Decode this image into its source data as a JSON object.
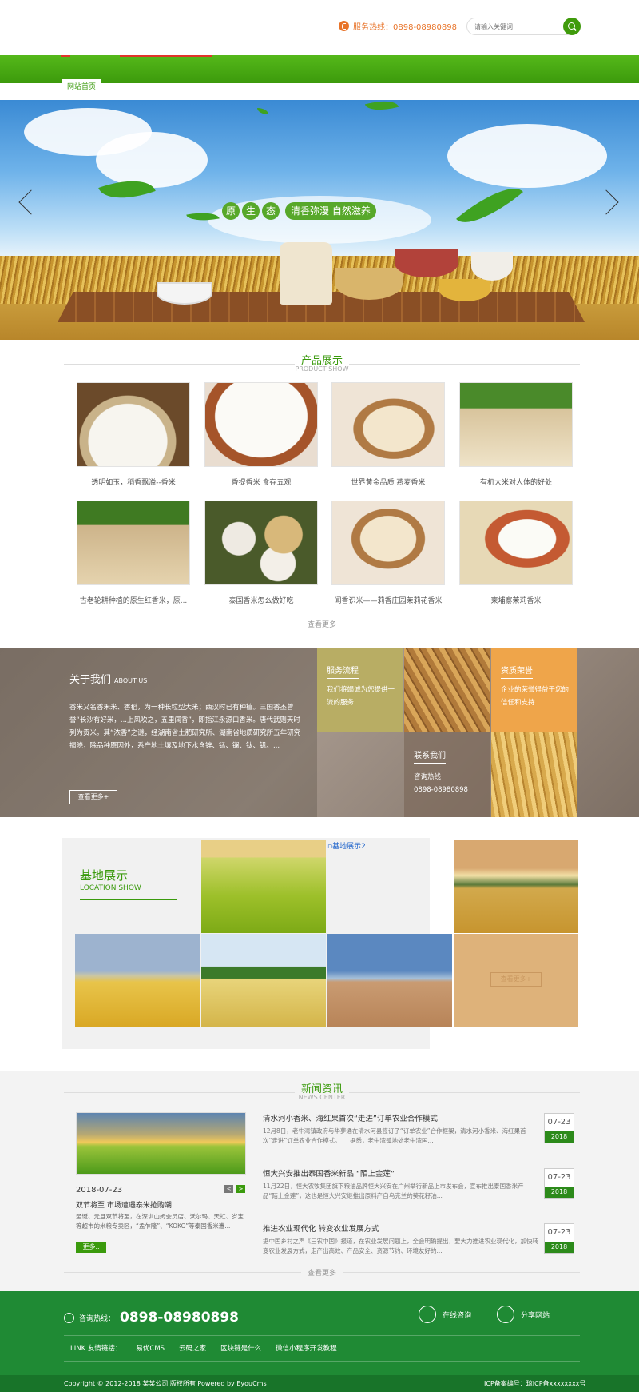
{
  "header": {
    "hotline": "服务热线：0898-08980898",
    "search_placeholder": "请输入关键词"
  },
  "nav": {
    "home": "网站首页"
  },
  "banner": {
    "slogan_chars": [
      "原",
      "生",
      "态"
    ],
    "slogan_rest": "清香弥漫 自然滋养"
  },
  "products": {
    "title": "产品展示",
    "subtitle": "PRODUCT SHOW",
    "items": [
      "透明如玉，稻香飘溢--香米",
      "香提香米 食存五观",
      "世界黄金品质 燕麦香米",
      "有机大米对人体的好处",
      "古老轮耕种植的原生红香米，原...",
      "泰国香米怎么做好吃",
      "闻香识米——莉香庄园茉莉花香米",
      "柬埔寨茉莉香米"
    ],
    "more": "查看更多"
  },
  "about": {
    "title": "关于我们",
    "title_en": "ABOUT US",
    "text": "香米又名香禾米、香稻，为一种长粒型大米；西汉时已有种植。三国香丕曾誉“长沙有好米，...上风吹之，五里闻香”，即指江永源口香米。唐代武则天时列为贡米。其“浓香”之谜，经湖南省土肥研究所、湖南省地质研究所五年研究揭晓，除品种原因外，系产地土壤及地下水含锌、锰、镧、钛、钒、...",
    "more": "查看更多+",
    "service_title": "服务流程",
    "service_desc": "我们将竭诚为您提供一流的服务",
    "honor_title": "资质荣誉",
    "honor_desc": "企业的荣誉得益于您的信任和支持",
    "contact_title": "联系我们",
    "contact_label": "咨询热线",
    "contact_phone": "0898-08980898"
  },
  "base": {
    "title": "基地展示",
    "subtitle": "LOCATION SHOW",
    "broken_img_alt": "基地展示2",
    "more": "查看更多+"
  },
  "news": {
    "title": "新闻资讯",
    "subtitle": "NEWS CENTER",
    "feature": {
      "date": "2018-07-23",
      "title": "双节将至 市场遭遇泰米抢购潮",
      "desc": "圣诞、元旦双节将至，在深圳山姆会员店、沃尔玛、天虹、岁宝等超市的米粮专卖区，“孟乍隆”、“KOKO”等泰国香米遭...",
      "more": "更多.."
    },
    "pager_prev": "<",
    "pager_next": ">",
    "items": [
      {
        "title": "清水河小香米、海红果首次“走进”订单农业合作模式",
        "desc": "12月8日，老牛湾镇政府与华夢通在清水河县签订了“订单农业”合作框架，清水河小香米、海红果首次“走进”订单农业合作模式。　　据悉，老牛湾镇地处老牛湾国...",
        "date": "07-23",
        "year": "2018"
      },
      {
        "title": "恒大兴安推出泰国香米新品 “陌上金莲”",
        "desc": "11月22日，恒大农牧集团旗下粮油品牌恒大兴安在广州举行新品上市发布会，宣布推出泰国香米产品“陌上金莲”，这也是恒大兴安继推出原料产自乌克兰的葵花籽油...",
        "date": "07-23",
        "year": "2018"
      },
      {
        "title": "推进农业现代化 转变农业发展方式",
        "desc": "据中国乡村之声《三农中国》报道，在农业发展问题上，全会明确提出，要大力推进农业现代化，加快转变农业发展方式，走产出高效、产品安全、资源节约、环境友好的...",
        "date": "07-23",
        "year": "2018"
      }
    ],
    "more": "查看更多"
  },
  "footer": {
    "hot_label": "咨询热线：",
    "hot_number": "0898-08980898",
    "online": "在线咨询",
    "share": "分享网站",
    "links_label": "LINK 友情链接：",
    "links": [
      "易优CMS",
      "云码之家",
      "区块链是什么",
      "微信小程序开发教程"
    ],
    "copyright": "Copyright © 2012-2018 某某公司 版权所有 Powered by EyouCms",
    "icp": "ICP备案编号：琼ICP备xxxxxxxx号"
  }
}
